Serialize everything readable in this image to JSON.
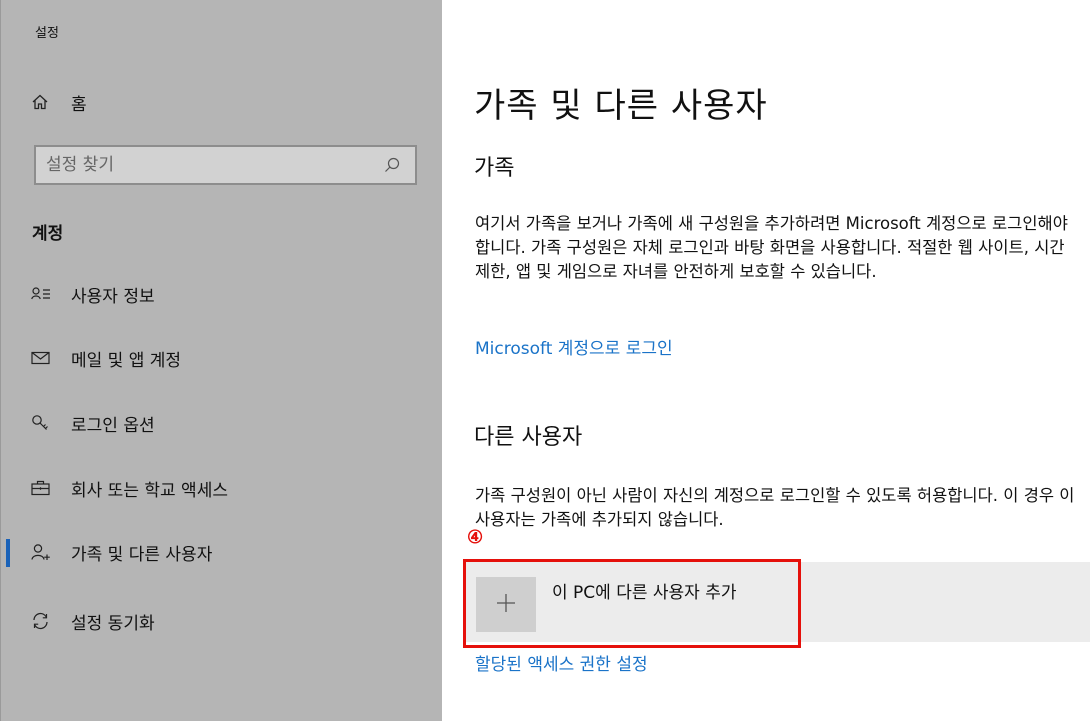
{
  "window": {
    "title": "설정"
  },
  "sidebar": {
    "home": {
      "label": "홈",
      "icon": "home-icon"
    },
    "search": {
      "placeholder": "설정 찾기",
      "value": "",
      "icon": "search-icon"
    },
    "section_heading": "계정",
    "items": [
      {
        "label": "사용자 정보",
        "icon": "user-info-icon",
        "active": false
      },
      {
        "label": "메일 및 앱 계정",
        "icon": "mail-icon",
        "active": false
      },
      {
        "label": "로그인 옵션",
        "icon": "key-icon",
        "active": false
      },
      {
        "label": "회사 또는 학교 액세스",
        "icon": "briefcase-icon",
        "active": false
      },
      {
        "label": "가족 및 다른 사용자",
        "icon": "add-person-icon",
        "active": true
      },
      {
        "label": "설정 동기화",
        "icon": "sync-icon",
        "active": false
      }
    ]
  },
  "main": {
    "title": "가족 및 다른 사용자",
    "family": {
      "heading": "가족",
      "description": "여기서 가족을 보거나 가족에 새 구성원을 추가하려면 Microsoft 계정으로 로그인해야 합니다. 가족 구성원은 자체 로그인과 바탕 화면을 사용합니다. 적절한 웹 사이트, 시간 제한, 앱 및 게임으로 자녀를 안전하게 보호할 수 있습니다.",
      "signin_link": "Microsoft 계정으로 로그인"
    },
    "other_users": {
      "heading": "다른 사용자",
      "description": "가족 구성원이 아닌 사람이 자신의 계정으로 로그인할 수 있도록 허용합니다. 이 경우 이 사용자는 가족에 추가되지 않습니다.",
      "add_button_label": "이 PC에 다른 사용자 추가",
      "assigned_access_link": "할당된 액세스 권한 설정"
    },
    "annotation": {
      "step_number": "④"
    }
  },
  "colors": {
    "sidebar_bg": "#b5b5b5",
    "accent": "#1a62b8",
    "link": "#1a73c8",
    "highlight": "#e5100b"
  }
}
